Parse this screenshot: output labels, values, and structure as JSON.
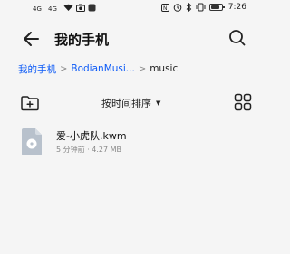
{
  "status_bar": {
    "left_icons": [
      "signal-4g-icon",
      "signal-4g-icon",
      "wifi-icon",
      "camera-icon",
      "app-icon"
    ],
    "left_labels": [
      "4G",
      "4G"
    ],
    "right_icons": [
      "nfc-icon",
      "alarm-icon",
      "bluetooth-icon",
      "vibrate-icon",
      "battery-icon"
    ],
    "time": "7:26"
  },
  "header": {
    "title": "我的手机"
  },
  "breadcrumb": {
    "items": [
      "我的手机",
      "BodianMusi...",
      "music"
    ]
  },
  "toolbar": {
    "sort_label": "按时间排序"
  },
  "files": [
    {
      "name": "爱-小虎队.kwm",
      "meta": "5 分钟前 · 4.27 MB"
    }
  ]
}
